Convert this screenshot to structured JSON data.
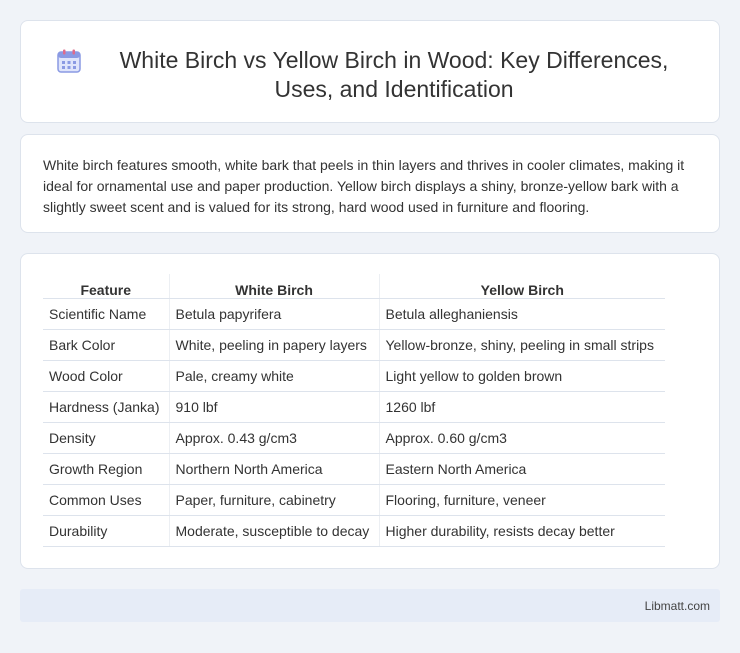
{
  "title": "White Birch vs Yellow Birch in Wood: Key Differences, Uses, and Identification",
  "intro": "White birch features smooth, white bark that peels in thin layers and thrives in cooler climates, making it ideal for ornamental use and paper production. Yellow birch displays a shiny, bronze-yellow bark with a slightly sweet scent and is valued for its strong, hard wood used in furniture and flooring.",
  "table": {
    "headers": [
      "Feature",
      "White Birch",
      "Yellow Birch"
    ],
    "rows": [
      [
        "Scientific Name",
        "Betula papyrifera",
        "Betula alleghaniensis"
      ],
      [
        "Bark Color",
        "White, peeling in papery layers",
        "Yellow-bronze, shiny, peeling in small strips"
      ],
      [
        "Wood Color",
        "Pale, creamy white",
        "Light yellow to golden brown"
      ],
      [
        "Hardness (Janka)",
        "910 lbf",
        "1260 lbf"
      ],
      [
        "Density",
        "Approx. 0.43 g/cm3",
        "Approx. 0.60 g/cm3"
      ],
      [
        "Growth Region",
        "Northern North America",
        "Eastern North America"
      ],
      [
        "Common Uses",
        "Paper, furniture, cabinetry",
        "Flooring, furniture, veneer"
      ],
      [
        "Durability",
        "Moderate, susceptible to decay",
        "Higher durability, resists decay better"
      ]
    ]
  },
  "footer": "Libmatt.com",
  "icon": "calendar-icon",
  "colors": {
    "background": "#f0f3f8",
    "footer_bg": "#e6ecf7",
    "icon_accent": "#7b8ee0"
  }
}
